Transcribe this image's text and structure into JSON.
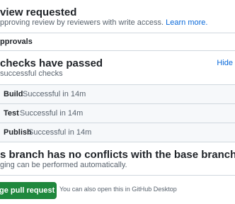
{
  "review": {
    "title": "view requested",
    "description": "pproving review by reviewers with write access.",
    "link_text": "Learn more."
  },
  "approvals": {
    "label": "pprovals"
  },
  "checks": {
    "title": "checks have passed",
    "description": "successful checks",
    "toggle_label": "Hide",
    "items": [
      {
        "name": "Build",
        "status": "Successful in 14m"
      },
      {
        "name": "Test",
        "status": "Successful in 14m"
      },
      {
        "name": "Publish",
        "status": "Successful in 14m"
      }
    ]
  },
  "conflicts": {
    "title": "s branch has no conflicts with the base branch",
    "description": "ging can be performed automatically."
  },
  "merge": {
    "button_label": "ge pull request",
    "hint": "You can also open this in GitHub Desktop"
  },
  "colors": {
    "accent": "#0969da",
    "merge_green": "#1f883d",
    "border": "#d0d7de",
    "muted_text": "#59636e"
  }
}
